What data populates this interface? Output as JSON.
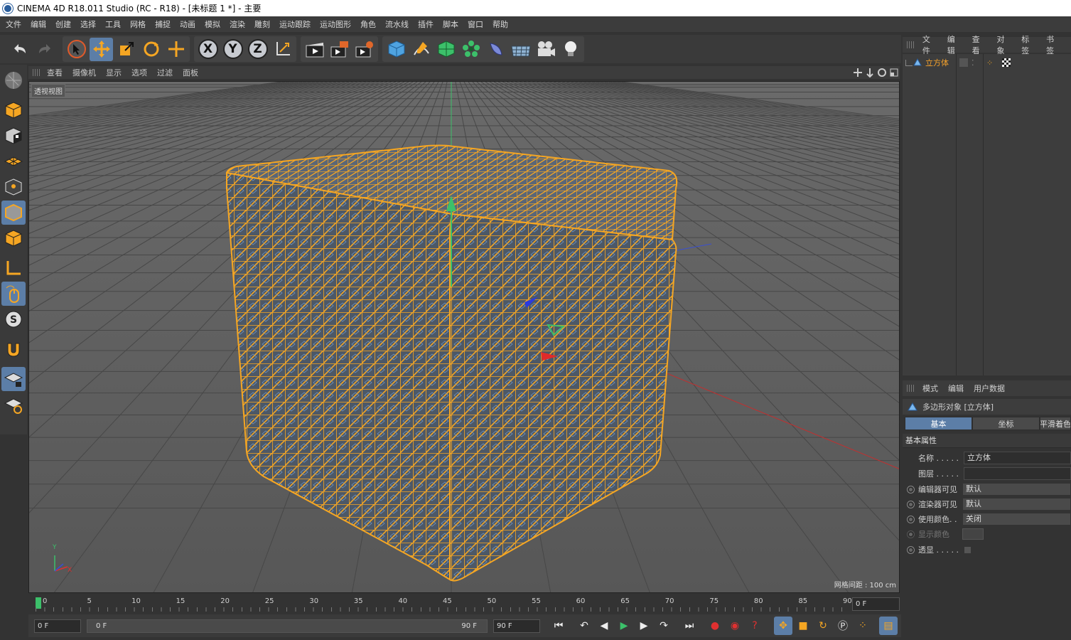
{
  "titlebar": {
    "title": "CINEMA 4D R18.011 Studio (RC - R18) - [未标题 1 *] - 主要"
  },
  "menubar": [
    "文件",
    "编辑",
    "创建",
    "选择",
    "工具",
    "网格",
    "捕捉",
    "动画",
    "模拟",
    "渲染",
    "雕刻",
    "运动跟踪",
    "运动图形",
    "角色",
    "流水线",
    "插件",
    "脚本",
    "窗口",
    "帮助"
  ],
  "toolbar": {
    "axis_x": "X",
    "axis_y": "Y",
    "axis_z": "Z"
  },
  "viewport": {
    "menu": [
      "查看",
      "摄像机",
      "显示",
      "选项",
      "过滤",
      "面板"
    ],
    "view_label": "透视视图",
    "grid_spacing": "网格间距 : 100 cm",
    "gizmo_y": "Y",
    "gizmo_x": "X"
  },
  "timeline": {
    "ticks": [
      "0",
      "5",
      "10",
      "15",
      "20",
      "25",
      "30",
      "35",
      "40",
      "45",
      "50",
      "55",
      "60",
      "65",
      "70",
      "75",
      "80",
      "85",
      "90"
    ],
    "current_frame": "0 F"
  },
  "transport": {
    "start": "0 F",
    "range_start": "0 F",
    "range_end": "90 F",
    "end": "90 F"
  },
  "object_manager": {
    "menu": [
      "文件",
      "编辑",
      "查看",
      "对象",
      "标签",
      "书签"
    ],
    "object_name": "立方体"
  },
  "attribute_manager": {
    "menu": [
      "模式",
      "编辑",
      "用户数据"
    ],
    "title": "多边形对象 [立方体]",
    "tabs": [
      "基本",
      "坐标",
      "平滑着色"
    ],
    "section": "基本属性",
    "rows": {
      "name_label": "名称 . . . . .",
      "name_value": "立方体",
      "layer_label": "图层 . . . . .",
      "editor_label": "编辑器可见",
      "editor_value": "默认",
      "render_label": "渲染器可见",
      "render_value": "默认",
      "usecolor_label": "使用颜色. .",
      "usecolor_value": "关闭",
      "displaycolor_label": "显示颜色",
      "xray_label": "透显 . . . . ."
    }
  },
  "colors": {
    "accent": "#5c7ea7",
    "selection": "#f6a22b",
    "viewport_bg": "#5a5a5a"
  }
}
